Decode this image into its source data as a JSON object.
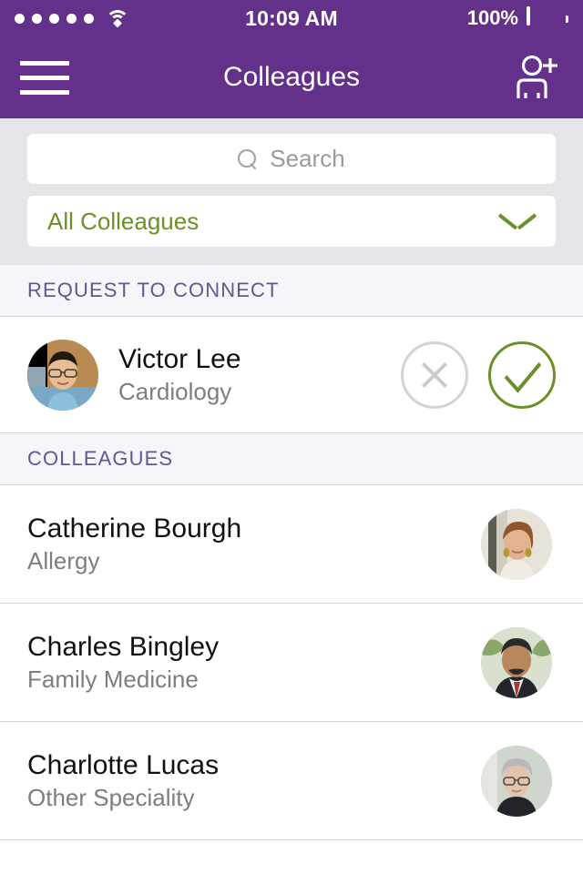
{
  "status_bar": {
    "signal_dots": 5,
    "wifi_icon": "wifi-icon",
    "time": "10:09 AM",
    "battery_percent": "100%",
    "battery_icon": "battery-full-icon"
  },
  "nav": {
    "menu_icon": "hamburger-menu-icon",
    "title": "Colleagues",
    "add_icon": "add-user-icon",
    "bg_color": "#633189"
  },
  "search": {
    "icon": "search-icon",
    "placeholder": "Search",
    "value": ""
  },
  "filter": {
    "selected": "All Colleagues",
    "chevron_icon": "chevron-down-icon",
    "accent_color": "#6b9028"
  },
  "sections": {
    "request_header": "REQUEST TO CONNECT",
    "colleagues_header": "COLLEAGUES"
  },
  "requests": [
    {
      "name": "Victor Lee",
      "specialty": "Cardiology",
      "avatar": "avatar-victor-lee",
      "reject_icon": "close-circle-icon",
      "accept_icon": "check-circle-icon"
    }
  ],
  "colleagues": [
    {
      "name": "Catherine Bourgh",
      "specialty": "Allergy",
      "avatar": "avatar-catherine-bourgh"
    },
    {
      "name": "Charles Bingley",
      "specialty": "Family Medicine",
      "avatar": "avatar-charles-bingley"
    },
    {
      "name": "Charlotte Lucas",
      "specialty": "Other Speciality",
      "avatar": "avatar-charlotte-lucas"
    }
  ]
}
